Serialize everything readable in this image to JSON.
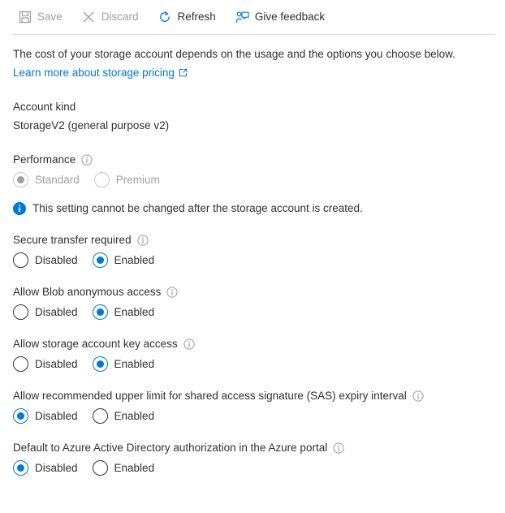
{
  "toolbar": {
    "commands": [
      {
        "id": "save",
        "label": "Save",
        "icon": "save-icon",
        "enabled": false
      },
      {
        "id": "discard",
        "label": "Discard",
        "icon": "discard-icon",
        "enabled": false
      },
      {
        "id": "refresh",
        "label": "Refresh",
        "icon": "refresh-icon",
        "enabled": true
      },
      {
        "id": "feedback",
        "label": "Give feedback",
        "icon": "feedback-icon",
        "enabled": true
      }
    ]
  },
  "intro": {
    "text": "The cost of your storage account depends on the usage and the options you choose below.",
    "link_text": "Learn more about storage pricing",
    "link_icon": "external-link-icon"
  },
  "account_kind": {
    "label": "Account kind",
    "value": "StorageV2 (general purpose v2)"
  },
  "performance": {
    "label": "Performance",
    "info_icon": "info-icon",
    "disabled": true,
    "options": [
      {
        "label": "Standard",
        "selected": true
      },
      {
        "label": "Premium",
        "selected": false
      }
    ],
    "message": {
      "icon": "info-filled-icon",
      "text": "This setting cannot be changed after the storage account is created."
    }
  },
  "settings": [
    {
      "id": "secure-transfer-required",
      "label": "Secure transfer required",
      "info_icon": "info-icon",
      "options": [
        {
          "label": "Disabled",
          "selected": false
        },
        {
          "label": "Enabled",
          "selected": true
        }
      ]
    },
    {
      "id": "allow-blob-anonymous-access",
      "label": "Allow Blob anonymous access",
      "info_icon": "info-icon",
      "options": [
        {
          "label": "Disabled",
          "selected": false
        },
        {
          "label": "Enabled",
          "selected": true
        }
      ]
    },
    {
      "id": "allow-storage-account-key-access",
      "label": "Allow storage account key access",
      "info_icon": "info-icon",
      "options": [
        {
          "label": "Disabled",
          "selected": false
        },
        {
          "label": "Enabled",
          "selected": true
        }
      ]
    },
    {
      "id": "allow-sas-expiry-interval-upper-limit",
      "label": "Allow recommended upper limit for shared access signature (SAS) expiry interval",
      "info_icon": "info-icon",
      "options": [
        {
          "label": "Disabled",
          "selected": true
        },
        {
          "label": "Enabled",
          "selected": false
        }
      ]
    },
    {
      "id": "default-to-aad-authorization",
      "label": "Default to Azure Active Directory authorization in the Azure portal",
      "info_icon": "info-icon",
      "options": [
        {
          "label": "Disabled",
          "selected": true
        },
        {
          "label": "Enabled",
          "selected": false
        }
      ]
    }
  ],
  "colors": {
    "accent": "#0078d4",
    "text": "#323130",
    "disabled_text": "#a19f9d",
    "divider": "#e1dfdd"
  }
}
